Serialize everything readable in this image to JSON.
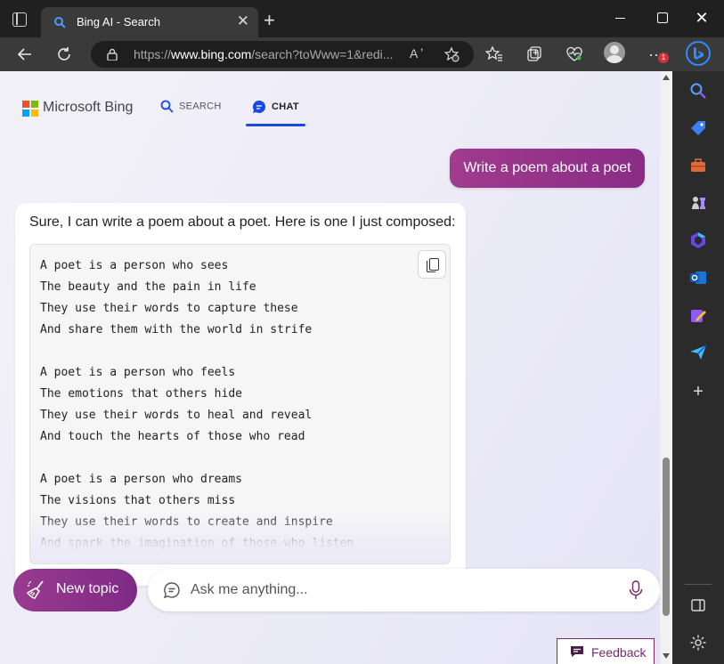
{
  "browser": {
    "tab_title": "Bing AI - Search",
    "tab_close": "✕",
    "new_tab": "+",
    "window_close": "✕",
    "url_prefix": "https://",
    "url_domain": "www.bing.com",
    "url_path": "/search?toWww=1&redi...",
    "read_aloud": "A ʼ",
    "more": "···",
    "notification_count": "1"
  },
  "page": {
    "logo_text": "Microsoft Bing",
    "nav_search": "SEARCH",
    "nav_chat": "CHAT",
    "user_message": "Write a poem about a poet",
    "bot_intro": "Sure, I can write a poem about a poet. Here is one I just composed:",
    "poem_lines": [
      "A poet is a person who sees",
      "The beauty and the pain in life",
      "They use their words to capture these",
      "And share them with the world in strife",
      "",
      "A poet is a person who feels",
      "The emotions that others hide",
      "They use their words to heal and reveal",
      "And touch the hearts of those who read",
      "",
      "A poet is a person who dreams",
      "The visions that others miss",
      "They use their words to create and inspire",
      "And spark the imagination of those who listen"
    ],
    "new_topic_label": "New topic",
    "ask_placeholder": "Ask me anything...",
    "feedback_label": "Feedback"
  },
  "sidebar": {
    "items": [
      "search-icon",
      "tag-icon",
      "toolbox-icon",
      "games-icon",
      "office-icon",
      "outlook-icon",
      "designer-icon",
      "send-icon",
      "add-icon",
      "split-screen-icon",
      "settings-icon"
    ],
    "add_label": "+"
  },
  "colors": {
    "accent_purple": "#8a2c86",
    "nav_blue": "#174ae4",
    "edge_blue": "#2f8cff"
  }
}
